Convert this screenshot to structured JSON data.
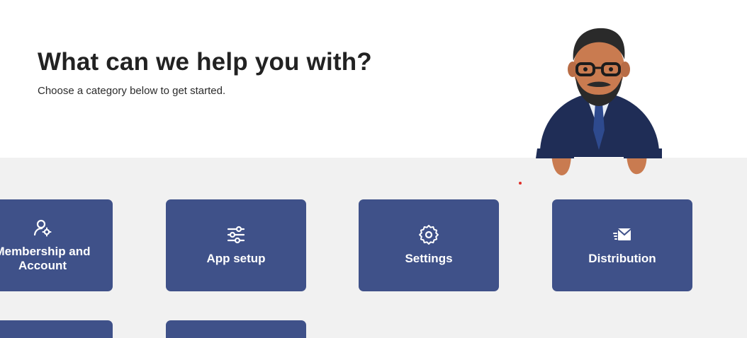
{
  "header": {
    "title": "What can we help you with?",
    "subtitle": "Choose a category below to get started."
  },
  "categories": [
    {
      "label": "Membership and\nAccount",
      "icon": "user-gear-icon"
    },
    {
      "label": "App setup",
      "icon": "sliders-icon"
    },
    {
      "label": "Settings",
      "icon": "gear-icon"
    },
    {
      "label": "Distribution",
      "icon": "send-mail-icon"
    }
  ],
  "colors": {
    "card": "#3f5189",
    "band": "#f1f1f1",
    "title": "#222222"
  }
}
